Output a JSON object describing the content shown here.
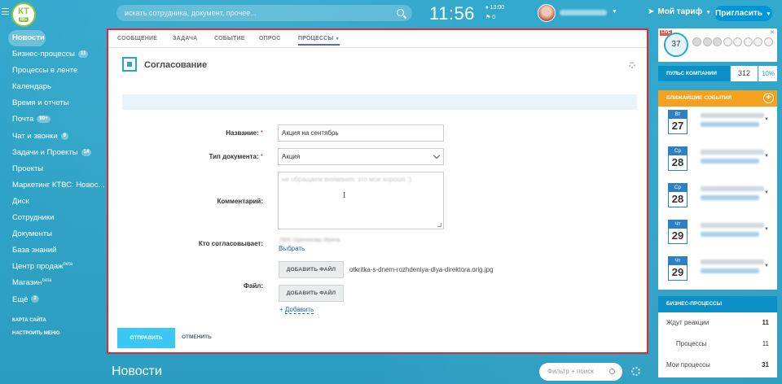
{
  "header": {
    "logo_top": "КТ",
    "logo_bottom": "ВС",
    "search_placeholder": "искать сотрудника, документ, прочее...",
    "clock": "11:56",
    "alarm_time": "13:00",
    "task_count": "0",
    "tariff_label": "Мой тариф",
    "invite_label": "Пригласить"
  },
  "sidebar": {
    "items": [
      {
        "label": "Новости",
        "counter": ""
      },
      {
        "label": "Бизнес-процессы",
        "counter": "11"
      },
      {
        "label": "Процессы в ленте",
        "counter": ""
      },
      {
        "label": "Календарь",
        "counter": ""
      },
      {
        "label": "Время и отчеты",
        "counter": ""
      },
      {
        "label": "Почта",
        "counter": "99+"
      },
      {
        "label": "Чат и звонки",
        "counter": "9"
      },
      {
        "label": "Задачи и Проекты",
        "counter": "14"
      },
      {
        "label": "Проекты",
        "counter": ""
      },
      {
        "label": "Маркетинг КТВС: Новос...",
        "counter": ""
      },
      {
        "label": "Диск",
        "counter": ""
      },
      {
        "label": "Сотрудники",
        "counter": ""
      },
      {
        "label": "Документы",
        "counter": ""
      },
      {
        "label": "База знаний",
        "counter": ""
      },
      {
        "label": "Центр продаж",
        "counter": ""
      },
      {
        "label": "Магазин",
        "counter": ""
      },
      {
        "label": "Ещё",
        "counter": "2"
      }
    ],
    "beta_label": "beta",
    "sitemap_label": "КАРТА САЙТА",
    "settings_label": "НАСТРОИТЬ МЕНЮ"
  },
  "form": {
    "tabs": [
      "СООБЩЕНИЕ",
      "ЗАДАЧА",
      "СОБЫТИЕ",
      "ОПРОС",
      "ПРОЦЕССЫ"
    ],
    "active_tab": "ПРОЦЕССЫ",
    "title": "Согласование",
    "name_label": "Название:",
    "name_value": "Акция на сентябрь",
    "doctype_label": "Тип документа:",
    "doctype_value": "Акция",
    "comment_label": "Комментарий:",
    "comment_placeholder": "не обращаем внимания, это мое хорошо :)",
    "approver_label": "Кто согласовывает:",
    "approver_name": "ЛМК Одинокова Ирина",
    "choose_link": "Выбрать",
    "file_label": "Файл:",
    "add_file_button": "ДОБАВИТЬ ФАЙЛ",
    "file_name": "otkritka-s-dnem-rozhdeniya-dlya-direktora.orig.jpg",
    "add_link": "Добавить",
    "submit_button": "ОТПРАВИТЬ",
    "cancel_button": "ОТМЕНИТЬ",
    "required_mark": "*"
  },
  "below": {
    "news_title": "Новости",
    "filter_placeholder": "Фильтр + поиск"
  },
  "right": {
    "live_label": "LIVE",
    "online_count": "37",
    "pulse_label": "ПУЛЬС КОМПАНИИ",
    "pulse_value": "312",
    "pulse_percent": "10%",
    "events_label": "БЛИЖАЙШИЕ СОБЫТИЯ",
    "events": [
      {
        "dow": "Вт",
        "day": "27"
      },
      {
        "dow": "Ср",
        "day": "28"
      },
      {
        "dow": "Ср",
        "day": "28"
      },
      {
        "dow": "Чт",
        "day": "29"
      },
      {
        "dow": "Чт",
        "day": "29"
      }
    ],
    "bp_label": "БИЗНЕС-ПРОЦЕССЫ",
    "bp_rows": [
      {
        "label": "Ждут реакции",
        "count": "11"
      },
      {
        "label": "Процессы",
        "count": "11"
      },
      {
        "label": "Мои процессы",
        "count": "31"
      }
    ]
  },
  "colors": {
    "background": "#2fa4c9",
    "highlight_border": "#d72d33",
    "events_header": "#f4a21e",
    "primary_button": "#3bc8f5"
  }
}
